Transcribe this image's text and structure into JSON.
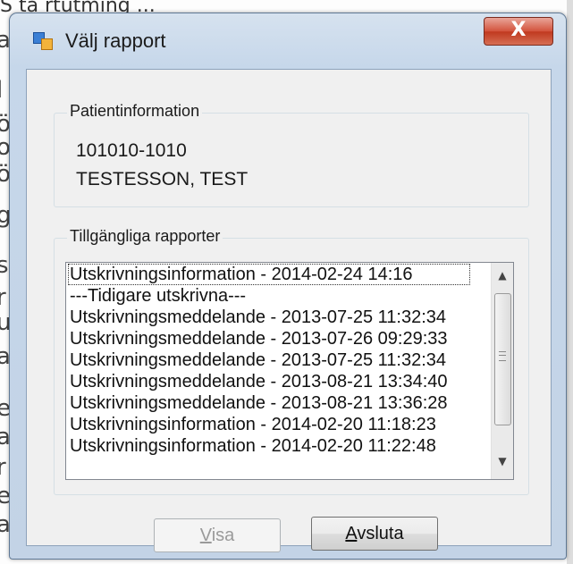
{
  "background": {
    "title_fragment": "S ta rtutming ...",
    "edge_letters": [
      "a",
      "l",
      "ö",
      "o",
      "ö",
      "g",
      "s",
      "r",
      "u",
      "a",
      "e",
      "a",
      "r",
      "e",
      "a"
    ]
  },
  "window": {
    "title": "Välj rapport",
    "close_label": "X"
  },
  "patient_group": {
    "label": "Patientinformation",
    "id_number": "101010-1010",
    "name": "TESTESSON, TEST"
  },
  "reports_group": {
    "label": "Tillgängliga rapporter",
    "items": [
      "Utskrivningsinformation - 2014-02-24 14:16",
      "---Tidigare utskrivna---",
      "Utskrivningsmeddelande - 2013-07-25 11:32:34",
      "Utskrivningsmeddelande - 2013-07-26 09:29:33",
      "Utskrivningsmeddelande - 2013-07-25 11:32:34",
      "Utskrivningsmeddelande - 2013-08-21 13:34:40",
      "Utskrivningsmeddelande - 2013-08-21 13:36:28",
      "Utskrivningsinformation - 2014-02-20 11:18:23",
      "Utskrivningsinformation - 2014-02-20 11:22:48"
    ]
  },
  "buttons": {
    "visa": {
      "mnemonic": "V",
      "rest": "isa",
      "enabled": false
    },
    "avsluta": {
      "mnemonic": "A",
      "rest": "vsluta",
      "enabled": true
    }
  },
  "icons": {
    "app": "app-window-icon",
    "close": "close-icon",
    "scroll_up": "scroll-up-arrow-icon",
    "scroll_down": "scroll-down-arrow-icon"
  }
}
